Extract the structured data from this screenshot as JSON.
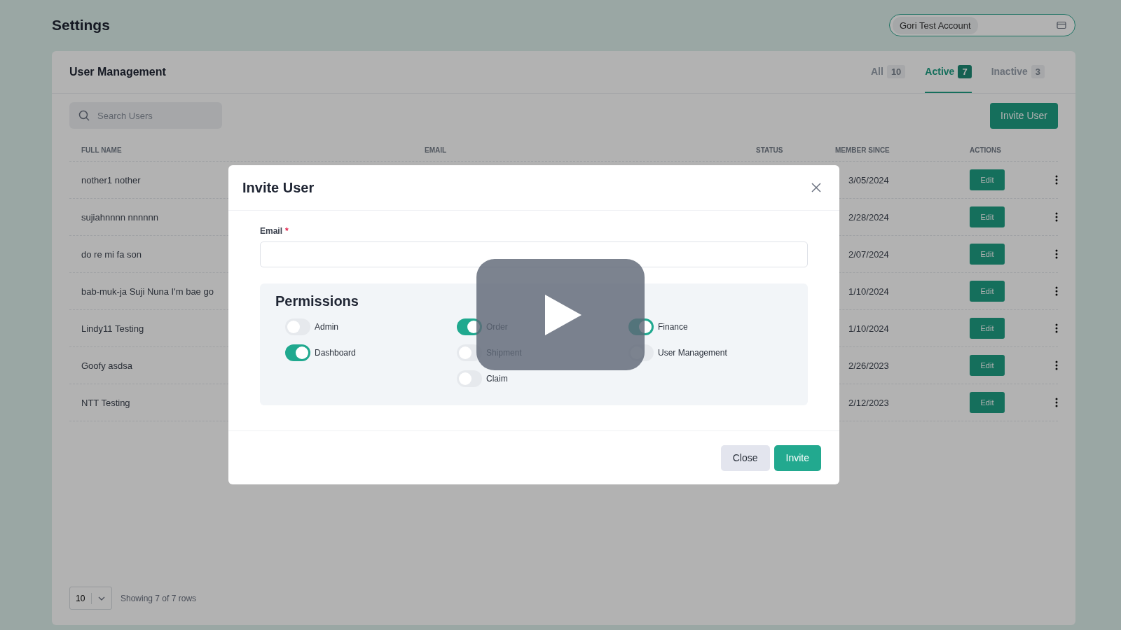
{
  "page": {
    "title": "Settings"
  },
  "account_selector": {
    "value": "Gori Test Account"
  },
  "card": {
    "title": "User Management",
    "tabs": [
      {
        "label": "All",
        "count": "10",
        "selected": false
      },
      {
        "label": "Active",
        "count": "7",
        "selected": true
      },
      {
        "label": "Inactive",
        "count": "3",
        "selected": false
      }
    ],
    "search": {
      "placeholder": "Search Users"
    },
    "invite_button": "Invite User",
    "table": {
      "columns": [
        "FULL NAME",
        "EMAIL",
        "STATUS",
        "MEMBER SINCE",
        "ACTIONS"
      ],
      "rows": [
        {
          "full_name": "nother1 nother",
          "member_since": "3/05/2024",
          "action": "Edit"
        },
        {
          "full_name": "sujiahnnnn nnnnnn",
          "member_since": "2/28/2024",
          "action": "Edit"
        },
        {
          "full_name": "do re mi fa son",
          "member_since": "2/07/2024",
          "action": "Edit"
        },
        {
          "full_name": "bab-muk-ja Suji Nuna I'm bae go",
          "member_since": "1/10/2024",
          "action": "Edit"
        },
        {
          "full_name": "Lindy11 Testing",
          "member_since": "1/10/2024",
          "action": "Edit"
        },
        {
          "full_name": "Goofy asdsa",
          "member_since": "2/26/2023",
          "action": "Edit"
        },
        {
          "full_name": "NTT Testing",
          "member_since": "2/12/2023",
          "action": "Edit"
        }
      ]
    },
    "pagination": {
      "page_size": "10",
      "summary": "Showing 7 of 7 rows"
    }
  },
  "modal": {
    "title": "Invite User",
    "email": {
      "label": "Email",
      "required_mark": "*"
    },
    "permissions": {
      "title": "Permissions",
      "columns": [
        [
          {
            "label": "Admin",
            "on": false
          },
          {
            "label": "Dashboard",
            "on": true
          }
        ],
        [
          {
            "label": "Order",
            "on": true
          },
          {
            "label": "Shipment",
            "on": false
          },
          {
            "label": "Claim",
            "on": false
          }
        ],
        [
          {
            "label": "Finance",
            "on": true
          },
          {
            "label": "User Management",
            "on": false
          }
        ]
      ]
    },
    "buttons": [
      {
        "label": "Close",
        "kind": "secondary"
      },
      {
        "label": "Invite",
        "kind": "primary"
      }
    ]
  }
}
